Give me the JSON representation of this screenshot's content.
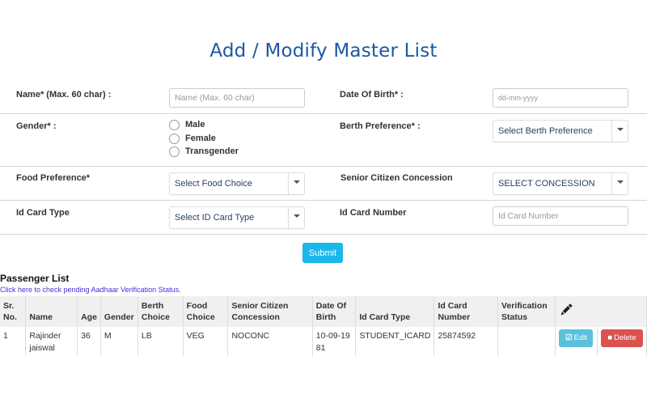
{
  "page": {
    "title": "Add / Modify Master List"
  },
  "form": {
    "name": {
      "label": "Name* (Max. 60 char) :",
      "placeholder": "Name (Max. 60 char)",
      "value": ""
    },
    "dob": {
      "label": "Date Of Birth* :",
      "placeholder": "dd-mm-yyyy",
      "value": ""
    },
    "gender": {
      "label": "Gender* :",
      "options": [
        "Male",
        "Female",
        "Transgender"
      ],
      "selected": null
    },
    "berth": {
      "label": "Berth Preference* :",
      "selected": "Select Berth Preference"
    },
    "food": {
      "label": "Food Preference*",
      "selected": "Select Food Choice"
    },
    "concession": {
      "label": "Senior Citizen Concession",
      "selected": "SELECT CONCESSION"
    },
    "id_type": {
      "label": "Id Card Type",
      "selected": "Select ID Card Type"
    },
    "id_number": {
      "label": "Id Card Number",
      "placeholder": "Id Card Number",
      "value": ""
    },
    "submit_label": "Submit"
  },
  "passenger_list": {
    "title": "Passenger List",
    "aadhaar_link": "Click here to check pending Aadhaar Verification Status.",
    "columns": [
      "Sr. No.",
      "Name",
      "Age",
      "Gender",
      "Berth Choice",
      "Food Choice",
      "Senior Citizen Concession",
      "Date Of Birth",
      "Id Card Type",
      "Id Card Number",
      "Verification Status"
    ],
    "actions_icon": "pencil-icon",
    "rows": [
      {
        "sr": "1",
        "name": "Rajinder jaiswal",
        "age": "36",
        "gender": "M",
        "berth": "LB",
        "food": "VEG",
        "concession": "NOCONC",
        "dob": "10-09-1981",
        "id_type": "STUDENT_ICARD",
        "id_number": "25874592",
        "verification": "",
        "edit_label": "Edit",
        "delete_label": "Delete"
      }
    ]
  },
  "colors": {
    "title": "#1f57a3",
    "submit": "#1ab7ea",
    "edit": "#5bc0de",
    "delete": "#d9534f",
    "link": "#4b2bd8"
  }
}
